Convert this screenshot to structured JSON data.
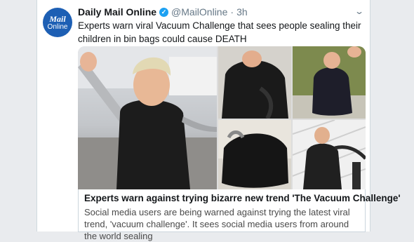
{
  "tweet": {
    "avatar": {
      "line1": "Mail",
      "line2": "Online"
    },
    "display_name": "Daily Mail Online",
    "handle": "@MailOnline",
    "separator": "·",
    "time": "3h",
    "text": "Experts warn viral Vacuum Challenge that sees people sealing their children in bin bags could cause DEATH",
    "more_icon": "chevron-down-icon"
  },
  "card": {
    "title": "Experts warn against trying bizarre new trend 'The Vacuum Challenge'",
    "description": "Social media users are being warned against trying the latest viral trend, 'vacuum challenge'. It sees social media users from around the world sealing"
  },
  "colors": {
    "brand": "#1d5fb4",
    "verified": "#1da1f2",
    "muted": "#657786"
  }
}
